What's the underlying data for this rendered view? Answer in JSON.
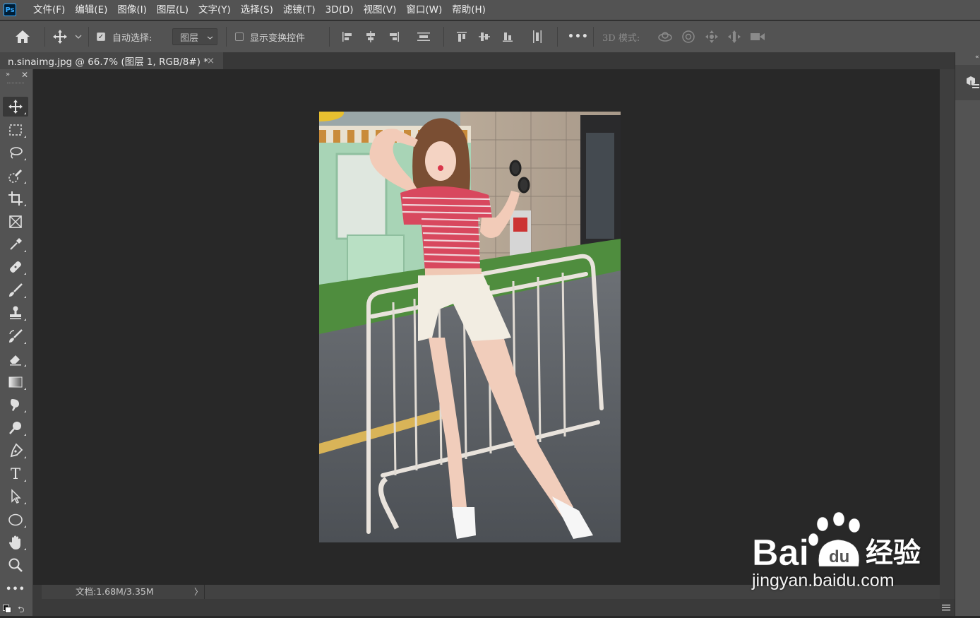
{
  "app": {
    "logo": "Ps"
  },
  "menu": [
    "文件(F)",
    "编辑(E)",
    "图像(I)",
    "图层(L)",
    "文字(Y)",
    "选择(S)",
    "滤镜(T)",
    "3D(D)",
    "视图(V)",
    "窗口(W)",
    "帮助(H)"
  ],
  "options": {
    "auto_select_label": "自动选择:",
    "auto_select_checked": true,
    "layer_dropdown_value": "图层",
    "show_transform_label": "显示变换控件",
    "show_transform_checked": false,
    "mode_3d_label": "3D 模式:",
    "more_label": "•••"
  },
  "tab": {
    "title": "n.sinaimg.jpg @ 66.7% (图层 1, RGB/8#) *",
    "close": "×"
  },
  "status": {
    "doc_info": "文档:1.68M/3.35M",
    "arrow": "〉"
  },
  "toolbar": {
    "tools": [
      "move",
      "marquee",
      "lasso",
      "quick-select",
      "crop",
      "frame",
      "eyedropper",
      "healing",
      "brush",
      "stamp",
      "history-brush",
      "eraser",
      "gradient",
      "smudge",
      "dodge",
      "pen",
      "type",
      "path-select",
      "ellipse",
      "hand",
      "zoom",
      "more"
    ],
    "type_glyph": "T",
    "more_glyph": "•••"
  },
  "watermark": {
    "brand": "Bai",
    "brand2": "经验",
    "url": "jingyan.baidu.com"
  },
  "colors": {
    "menubar": "#535353",
    "canvas": "#282828",
    "panel": "#535353",
    "accent_ps": "#31a8ff"
  }
}
